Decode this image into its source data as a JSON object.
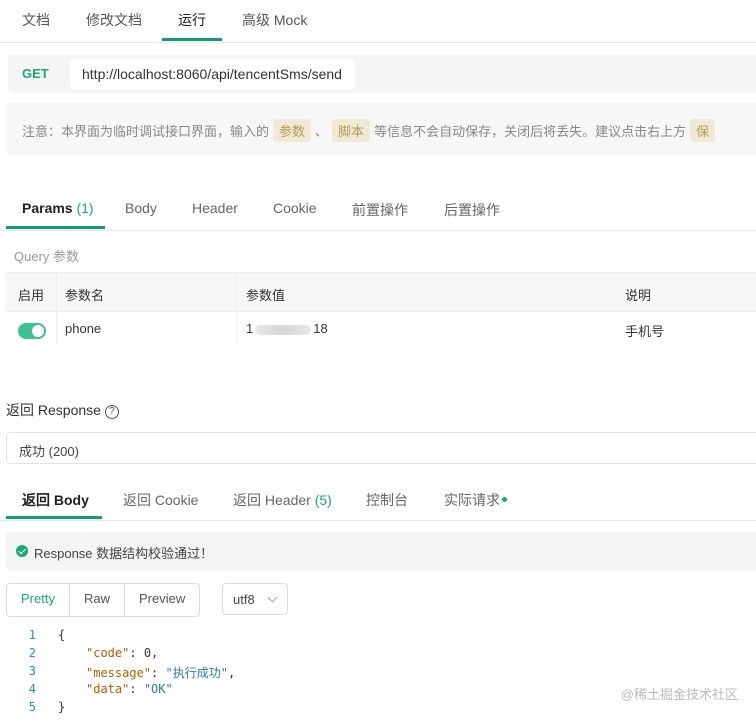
{
  "top_tabs": [
    "文档",
    "修改文档",
    "运行",
    "高级 Mock"
  ],
  "request": {
    "method": "GET",
    "url": "http://localhost:8060/api/tencentSms/send"
  },
  "notice": {
    "prefix": "注意：本界面为临时调试接口界面，输入的",
    "chip1": "参数",
    "sep": "、",
    "chip2": "脚本",
    "middle": "等信息不会自动保存，关闭后将丢失。建议点击右上方",
    "chip3": "保"
  },
  "param_tabs": {
    "params": "Params",
    "params_count": "(1)",
    "body": "Body",
    "header": "Header",
    "cookie": "Cookie",
    "pre": "前置操作",
    "post": "后置操作"
  },
  "query_label": "Query 参数",
  "table": {
    "headers": [
      "启用",
      "参数名",
      "参数值",
      "说明"
    ],
    "row": {
      "enabled": true,
      "name": "phone",
      "value_start": "1",
      "value_end": "18",
      "desc": "手机号"
    }
  },
  "response": {
    "title": "返回 Response",
    "help_icon": "question-circle-icon",
    "status": "成功 (200)",
    "tabs": {
      "body": "返回 Body",
      "cookie": "返回 Cookie",
      "header": "返回 Header",
      "header_count": "(5)",
      "console": "控制台",
      "actual": "实际请求"
    },
    "validation": "Response 数据结构校验通过！",
    "view_modes": [
      "Pretty",
      "Raw",
      "Preview"
    ],
    "active_view": "Pretty",
    "encoding": "utf8"
  },
  "code_lines": {
    "l1": "{",
    "k2": "\"code\"",
    "v2": "0",
    "k3": "\"message\"",
    "v3": "\"执行成功\"",
    "k4": "\"data\"",
    "v4": "\"OK\"",
    "l5": "}"
  },
  "watermark": "@稀土掘金技术社区",
  "colors": {
    "accent": "#0f9d76",
    "method": "#19a974"
  }
}
